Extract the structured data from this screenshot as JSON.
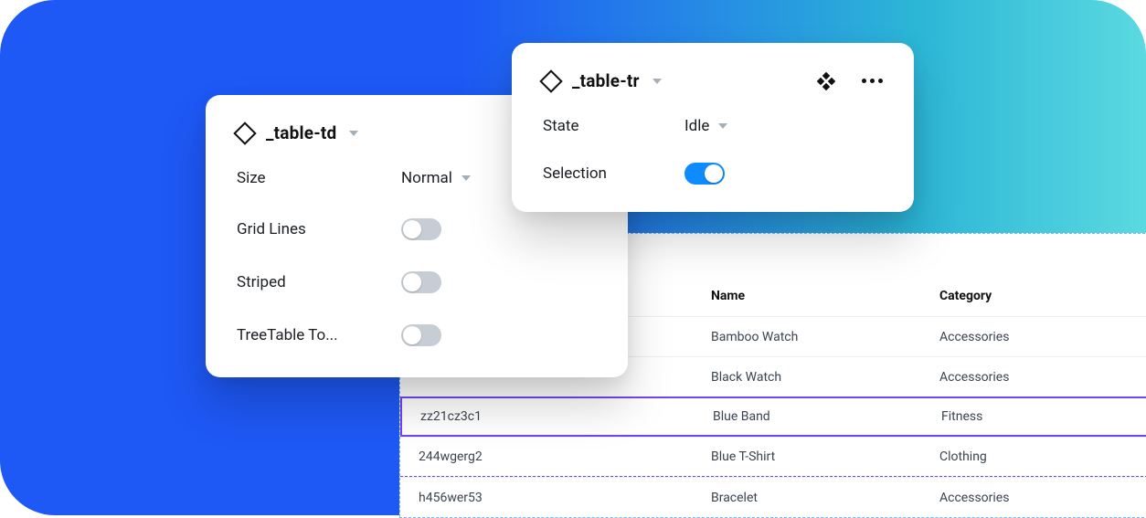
{
  "panel_td": {
    "title": "_table-td",
    "rows": {
      "size": {
        "label": "Size",
        "value": "Normal"
      },
      "grid_lines": {
        "label": "Grid Lines",
        "on": false
      },
      "striped": {
        "label": "Striped",
        "on": false
      },
      "treetable": {
        "label": "TreeTable To...",
        "on": false
      }
    }
  },
  "panel_tr": {
    "title": "_table-tr",
    "rows": {
      "state": {
        "label": "State",
        "value": "Idle"
      },
      "selection": {
        "label": "Selection",
        "on": true
      }
    }
  },
  "table": {
    "headers": {
      "name": "Name",
      "category": "Category"
    },
    "rows": [
      {
        "code": "",
        "name": "Bamboo Watch",
        "category": "Accessories",
        "kind": "normal"
      },
      {
        "code": "",
        "name": "Black Watch",
        "category": "Accessories",
        "kind": "normal"
      },
      {
        "code": "zz21cz3c1",
        "name": "Blue Band",
        "category": "Fitness",
        "kind": "selected"
      },
      {
        "code": "244wgerg2",
        "name": "Blue T-Shirt",
        "category": "Clothing",
        "kind": "dashed"
      },
      {
        "code": "h456wer53",
        "name": "Bracelet",
        "category": "Accessories",
        "kind": "normal"
      }
    ]
  }
}
